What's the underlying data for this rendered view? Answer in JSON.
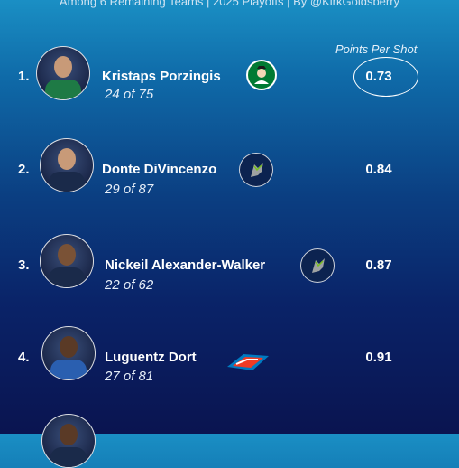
{
  "header": {
    "subtitle": "Among 6 Remaining Teams  |  2025 Playoffs  |  By @KirkGoldsberry"
  },
  "column_label": "Points Per Shot",
  "rows": [
    {
      "rank": "1.",
      "name": "Kristaps Porzingis",
      "stat": "24 of 75",
      "value": "0.73",
      "team_logo": "celtics-logo"
    },
    {
      "rank": "2.",
      "name": "Donte DiVincenzo",
      "stat": "29 of 87",
      "value": "0.84",
      "team_logo": "timberwolves-logo"
    },
    {
      "rank": "3.",
      "name": "Nickeil Alexander-Walker",
      "stat": "22 of 62",
      "value": "0.87",
      "team_logo": "timberwolves-logo"
    },
    {
      "rank": "4.",
      "name": "Luguentz Dort",
      "stat": "27 of 81",
      "value": "0.91",
      "team_logo": "thunder-logo"
    }
  ],
  "colors": {
    "celtics": "#007a33",
    "timberwolves": "#0c2340",
    "thunder": "#ef3b24"
  }
}
